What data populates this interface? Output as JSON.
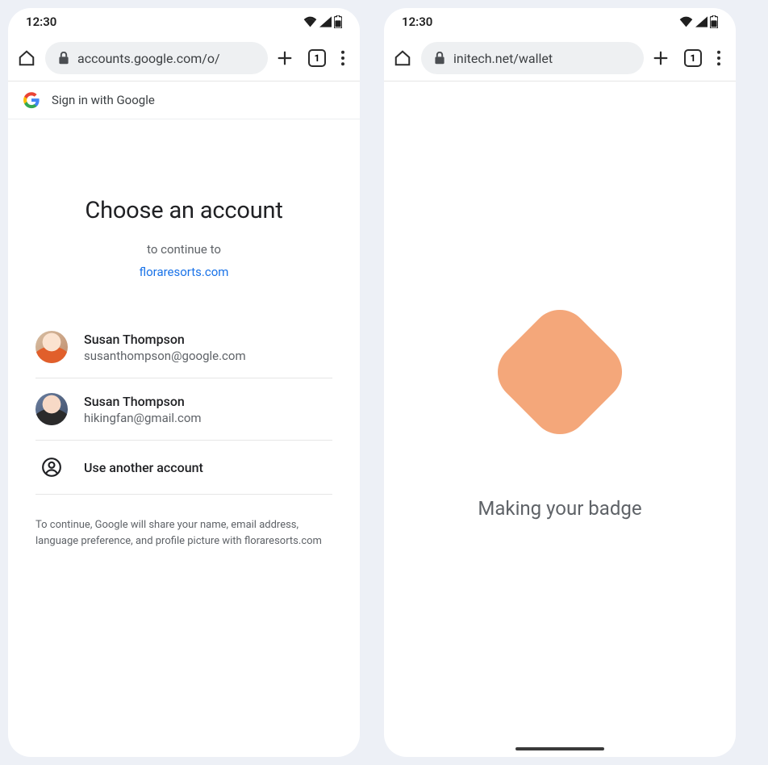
{
  "status": {
    "time": "12:30",
    "tab_count": "1"
  },
  "left": {
    "url": "accounts.google.com/o/",
    "banner": "Sign in with Google",
    "title": "Choose an account",
    "continue": "to continue to",
    "relying_party": "floraresorts.com",
    "accounts": [
      {
        "name": "Susan Thompson",
        "email": "susanthompson@google.com"
      },
      {
        "name": "Susan Thompson",
        "email": "hikingfan@gmail.com"
      }
    ],
    "another": "Use another account",
    "disclaimer": "To continue, Google will share your name, email address, language preference, and profile picture with floraresorts.com"
  },
  "right": {
    "url": "initech.net/wallet",
    "message": "Making your badge"
  }
}
